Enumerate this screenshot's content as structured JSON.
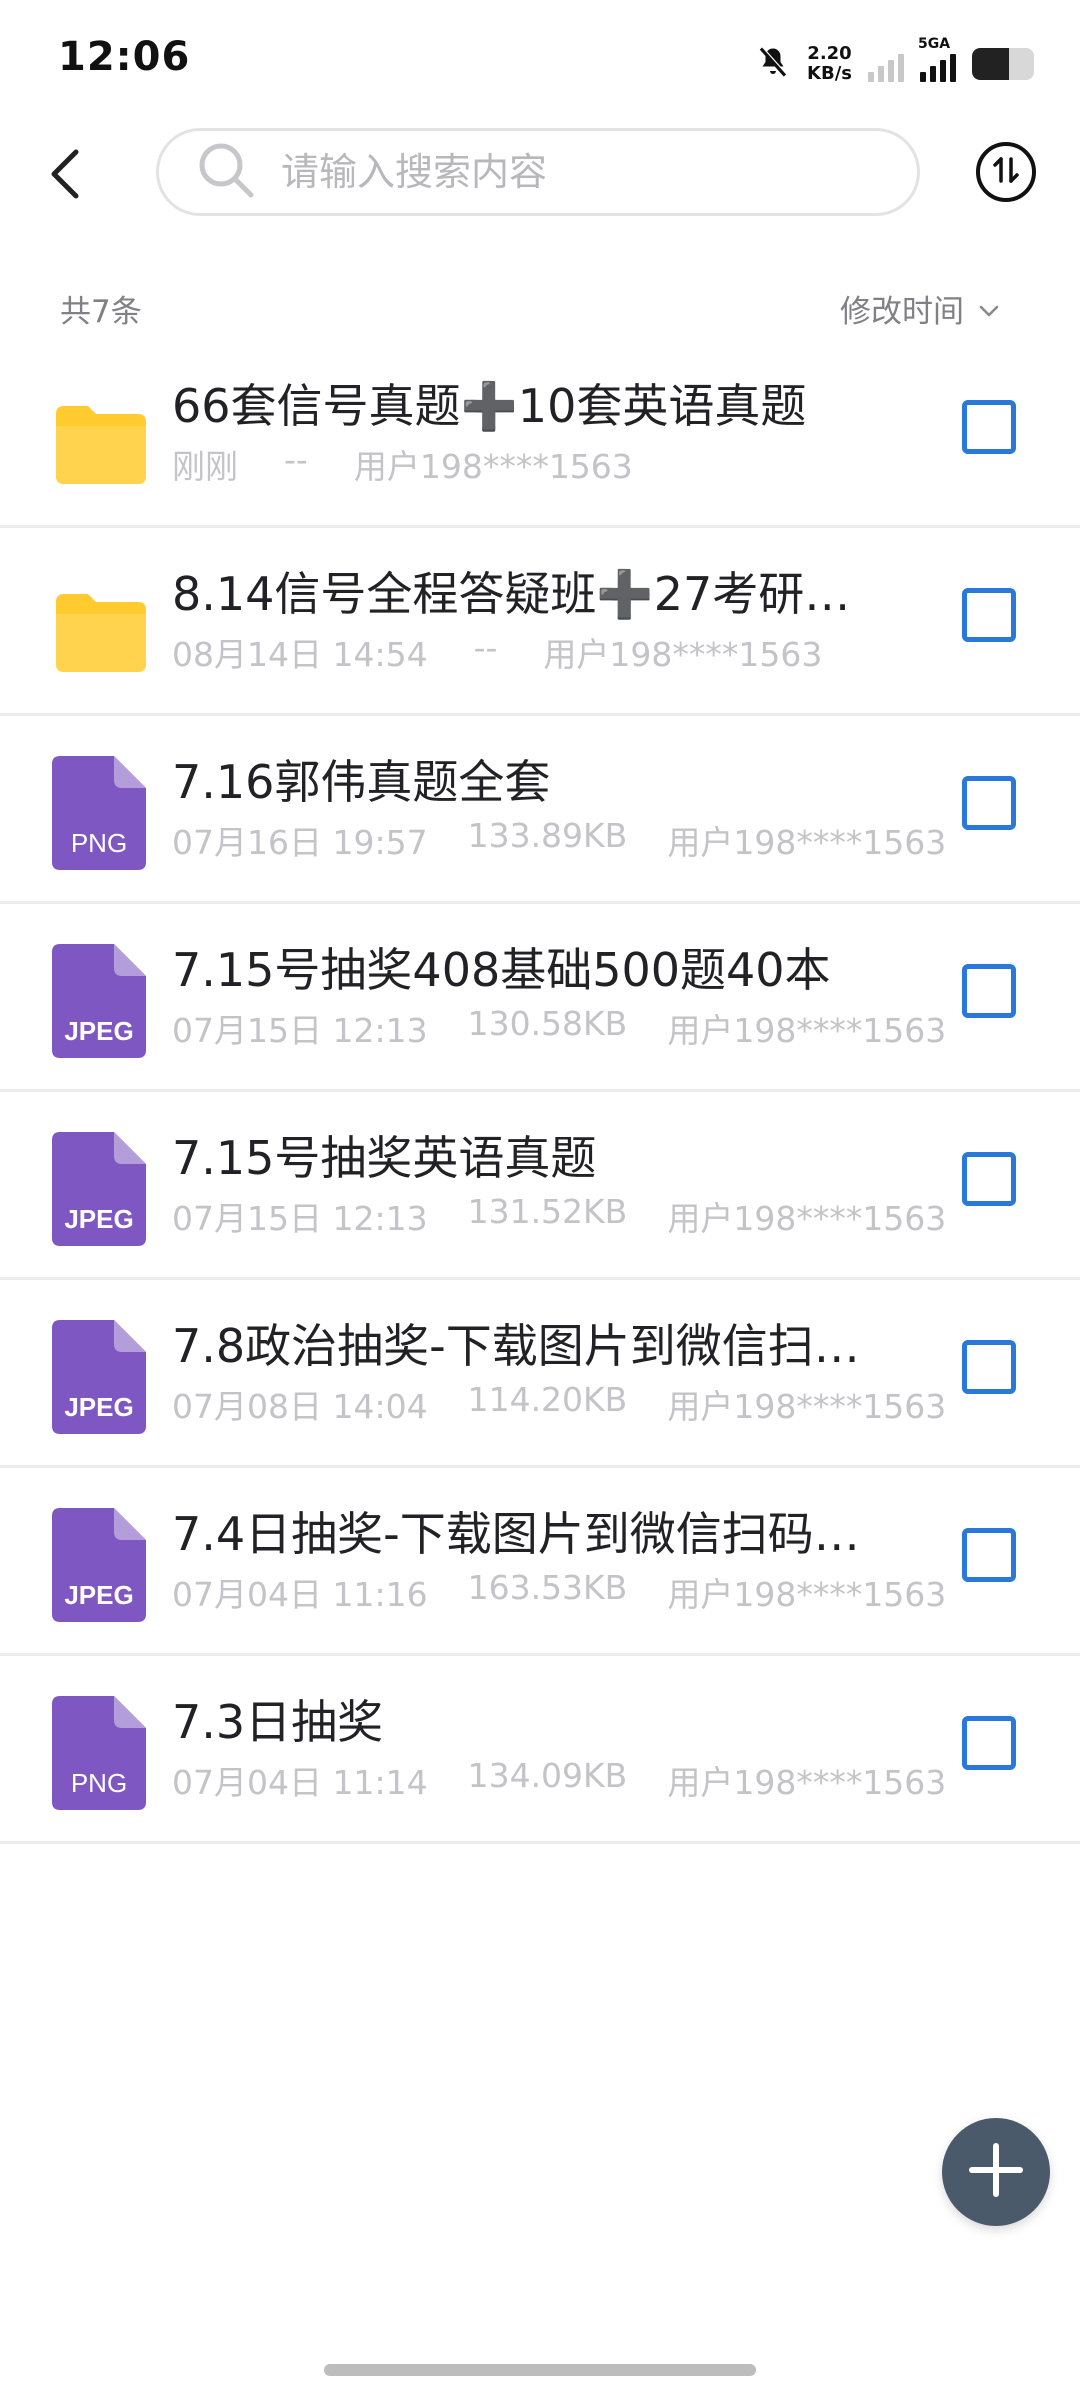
{
  "status_bar": {
    "time": "12:06",
    "net_speed_value": "2.20",
    "net_speed_unit": "KB/s",
    "network_type": "5GA",
    "battery_level": 0.6
  },
  "header": {
    "search_placeholder": "请输入搜索内容"
  },
  "list_meta": {
    "count_text": "共7条",
    "sort_label": "修改时间"
  },
  "files": [
    {
      "type": "folder",
      "name": "66套信号真题➕10套英语真题",
      "date": "刚刚",
      "size": "--",
      "owner": "用户198****1563"
    },
    {
      "type": "folder",
      "name": "8.14信号全程答疑班➕27考研…",
      "date": "08月14日 14:54",
      "size": "--",
      "owner": "用户198****1563"
    },
    {
      "type": "PNG",
      "name": "7.16郭伟真题全套",
      "date": "07月16日 19:57",
      "size": "133.89KB",
      "owner": "用户198****1563"
    },
    {
      "type": "JPEG",
      "name": "7.15号抽奖408基础500题40本",
      "date": "07月15日 12:13",
      "size": "130.58KB",
      "owner": "用户198****1563"
    },
    {
      "type": "JPEG",
      "name": "7.15号抽奖英语真题",
      "date": "07月15日 12:13",
      "size": "131.52KB",
      "owner": "用户198****1563"
    },
    {
      "type": "JPEG",
      "name": "7.8政治抽奖-下载图片到微信扫…",
      "date": "07月08日 14:04",
      "size": "114.20KB",
      "owner": "用户198****1563"
    },
    {
      "type": "JPEG",
      "name": "7.4日抽奖-下载图片到微信扫码…",
      "date": "07月04日 11:16",
      "size": "163.53KB",
      "owner": "用户198****1563"
    },
    {
      "type": "PNG",
      "name": "7.3日抽奖",
      "date": "07月04日 11:14",
      "size": "134.09KB",
      "owner": "用户198****1563"
    }
  ],
  "colors": {
    "folder": "#ffcb2f",
    "file_icon": "#7e57c2",
    "checkbox": "#2a78d9",
    "fab": "#4b5a6b"
  },
  "icons": {
    "back": "chevron-left-icon",
    "search": "search-icon",
    "sort": "sort-icon",
    "sort_dropdown": "chevron-down-icon",
    "add": "plus-icon"
  }
}
